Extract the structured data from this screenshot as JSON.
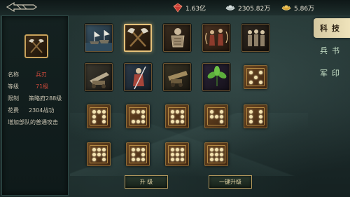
{
  "header": {
    "resources": [
      {
        "icon": "ruby-icon",
        "value": "1.63亿",
        "color": "#d6423a"
      },
      {
        "icon": "silver-ingot-icon",
        "value": "2305.82万",
        "color": "#cfd8d6"
      },
      {
        "icon": "gold-ingot-icon",
        "value": "5.86万",
        "color": "#e0b54a"
      }
    ]
  },
  "left_panel": {
    "name_label": "名称",
    "name_value": "兵刃",
    "level_label": "等级",
    "level_value": "71级",
    "limit_label": "限制",
    "limit_value": "策略府288级",
    "cost_label": "花费",
    "cost_value": "2304战功",
    "description": "增加部队的普通攻击"
  },
  "tabs": [
    {
      "label": "科技",
      "active": true
    },
    {
      "label": "兵书",
      "active": false
    },
    {
      "label": "军印",
      "active": false
    }
  ],
  "tech_items": [
    {
      "name": "tech-fleet",
      "icon": "fleet-icon",
      "state": "unlocked"
    },
    {
      "name": "tech-axes",
      "icon": "crossed-axes-icon",
      "state": "selected"
    },
    {
      "name": "tech-armor",
      "icon": "armor-icon",
      "state": "unlocked"
    },
    {
      "name": "tech-archers",
      "icon": "archers-icon",
      "state": "unlocked"
    },
    {
      "name": "tech-soldiers",
      "icon": "soldiers-icon",
      "state": "unlocked"
    },
    {
      "name": "tech-ballista",
      "icon": "ballista-icon",
      "state": "unlocked"
    },
    {
      "name": "tech-warrior",
      "icon": "warrior-icon",
      "state": "unlocked"
    },
    {
      "name": "tech-cannon",
      "icon": "cannon-icon",
      "state": "unlocked"
    },
    {
      "name": "tech-herb",
      "icon": "herb-icon",
      "state": "unlocked"
    },
    {
      "name": "tech-locked-1",
      "icon": "lock-pattern-icon",
      "state": "locked",
      "dots": [
        1,
        0,
        1,
        0,
        1,
        0,
        1,
        0,
        1
      ]
    },
    {
      "name": "tech-locked-2",
      "icon": "lock-pattern-icon",
      "state": "locked",
      "dots": [
        1,
        1,
        1,
        1,
        0,
        1,
        1,
        0,
        1
      ]
    },
    {
      "name": "tech-locked-3",
      "icon": "lock-pattern-icon",
      "state": "locked",
      "dots": [
        1,
        1,
        1,
        0,
        0,
        1,
        1,
        1,
        1
      ]
    },
    {
      "name": "tech-locked-4",
      "icon": "lock-pattern-icon",
      "state": "locked",
      "dots": [
        1,
        1,
        1,
        1,
        0,
        1,
        1,
        1,
        1
      ]
    },
    {
      "name": "tech-locked-5",
      "icon": "lock-pattern-icon",
      "state": "locked",
      "dots": [
        1,
        0,
        1,
        1,
        1,
        1,
        0,
        0,
        1
      ]
    },
    {
      "name": "tech-locked-6",
      "icon": "lock-pattern-icon",
      "state": "locked",
      "dots": [
        1,
        0,
        1,
        1,
        0,
        1,
        1,
        0,
        1
      ]
    },
    {
      "name": "tech-locked-7",
      "icon": "lock-pattern-icon",
      "state": "locked",
      "dots": [
        1,
        1,
        1,
        1,
        1,
        1,
        1,
        0,
        1
      ]
    },
    {
      "name": "tech-locked-8",
      "icon": "lock-pattern-icon",
      "state": "locked",
      "dots": [
        1,
        1,
        1,
        1,
        0,
        1,
        1,
        1,
        1
      ]
    },
    {
      "name": "tech-locked-9",
      "icon": "lock-pattern-icon",
      "state": "locked",
      "dots": [
        1,
        1,
        1,
        1,
        1,
        1,
        1,
        1,
        1
      ]
    }
  ],
  "buttons": {
    "upgrade": "升 级",
    "one_click_upgrade": "一键升级"
  }
}
